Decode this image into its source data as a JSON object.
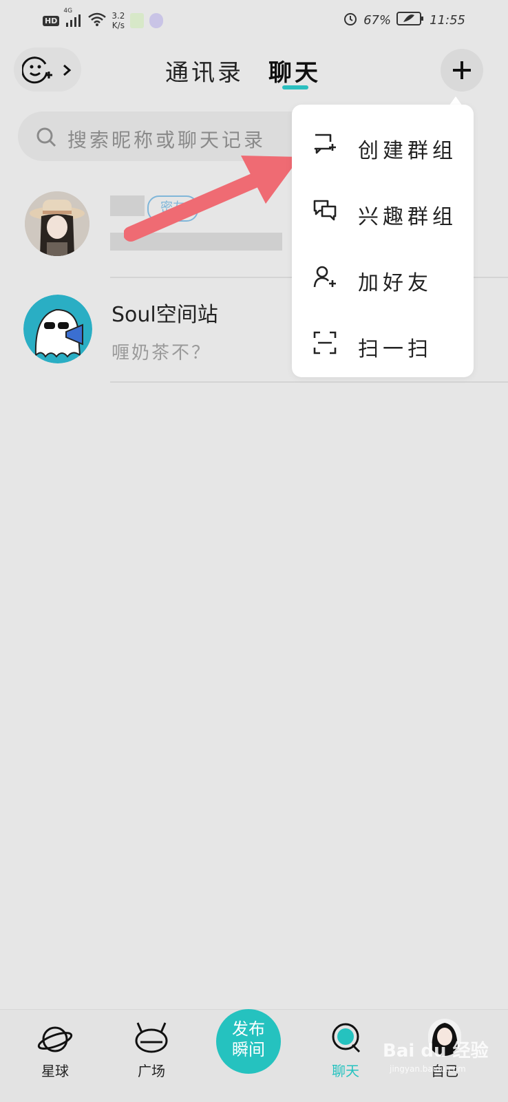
{
  "status_bar": {
    "hd": "HD",
    "network": "4G",
    "speed_value": "3.2",
    "speed_unit": "K/s",
    "battery": "67%",
    "time": "11:55"
  },
  "header": {
    "tabs": [
      {
        "label": "通讯录"
      },
      {
        "label": "聊天"
      }
    ]
  },
  "search": {
    "placeholder": "搜索昵称或聊天记录"
  },
  "conversations": [
    {
      "tag": "密友",
      "preview": ""
    },
    {
      "name": "Soul空间站",
      "preview": "喱奶茶不？"
    }
  ],
  "popup_menu": {
    "items": [
      {
        "label": "创建群组",
        "icon": "chat-plus-icon"
      },
      {
        "label": "兴趣群组",
        "icon": "chat-bubbles-icon"
      },
      {
        "label": "加好友",
        "icon": "add-person-icon"
      },
      {
        "label": "扫一扫",
        "icon": "scan-icon"
      }
    ]
  },
  "bottom_nav": {
    "items": [
      {
        "label": "星球"
      },
      {
        "label": "广场"
      },
      {
        "label": "聊天"
      },
      {
        "label": "自己"
      }
    ],
    "publish": {
      "line1": "发布",
      "line2": "瞬间"
    }
  },
  "watermark": {
    "text": "Bai du 经验",
    "sub": "jingyan.baidu.com"
  },
  "colors": {
    "accent": "#25c2bf",
    "background": "#e6e6e6",
    "arrow": "#ef6b73"
  }
}
